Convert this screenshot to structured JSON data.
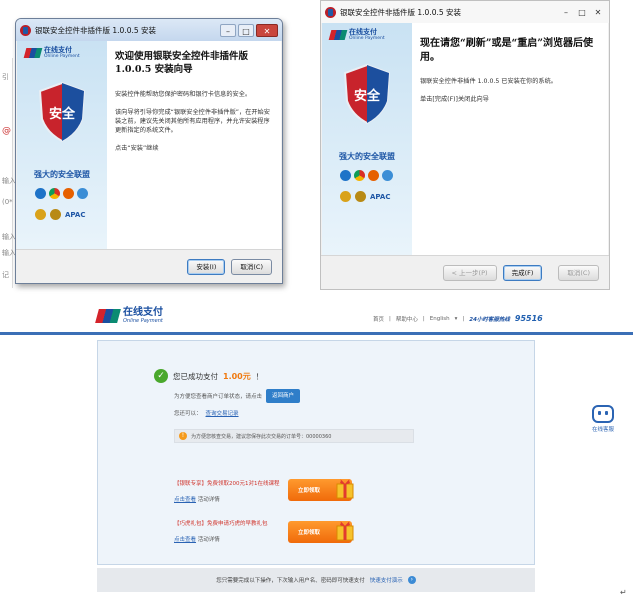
{
  "installer_welcome": {
    "title": "银联安全控件非插件版 1.0.0.5 安装",
    "heading": "欢迎使用银联安全控件非插件版 1.0.0.5 安装向导",
    "para1": "安装控件能帮助您保护密码和银行卡信息的安全。",
    "para2": "该向导将引导你完成“银联安全控件非插件版”，在开始安装之前，建议先关闭其他所有应用程序，并允许安装程序更新指定的系统文件。",
    "para3": "点击“安装”继续",
    "install_label": "安装(I)",
    "cancel_label": "取消(C)"
  },
  "installer_finish": {
    "title": "银联安全控件非插件版 1.0.0.5 安装",
    "heading": "现在请您“刷新”或是“重启”浏览器后使用。",
    "para1": "银联安全控件非插件 1.0.0.5 已安装在你的系统。",
    "para2": "单击[完成(F)]关闭此向导",
    "back_label": "< 上一步(P)",
    "finish_label": "完成(F)",
    "cancel_label": "取消(C)"
  },
  "sidebar": {
    "logo_text": "在线支付",
    "logo_sub": "Online Payment",
    "shield_text": "安全",
    "caption": "强大的安全联盟",
    "apac": "APAC"
  },
  "pay_header": {
    "logo_text": "在线支付",
    "logo_sub": "Online Payment",
    "nav_home": "首页",
    "nav_help": "帮助中心",
    "nav_lang": "English",
    "hotline_label": "24小时客服热线",
    "hotline_number": "95516"
  },
  "result": {
    "success_prefix": "您已成功支付",
    "amount": "1.00元",
    "success_suffix": "！",
    "view_status_text": "为方便您查看商户订单状态，请点击",
    "return_button": "返回商户",
    "also_can": "您还可以：",
    "query_link": "查询交易记录",
    "notice": "为方便您核查交易，建议您保存此次交易的订单号：00000360",
    "promo1_title": "【银联专享】免费领取200元1对1在线课程",
    "promo1_link": "点击查看",
    "promo1_detail": "活动详情",
    "promo1_button": "立即领取",
    "promo2_title": "【巧虎礼包】免费申请巧虎的早教礼包",
    "promo2_link": "点击查看",
    "promo2_detail": "活动详情",
    "promo2_button": "立即领取",
    "bottom_text": "您只需要完成以下操作，下次输入用户名、密码即可快速支付",
    "bottom_link": "快速支付演示"
  },
  "service": {
    "label": "在线客服"
  },
  "background_fragments": [
    "引",
    "输入",
    "(0*",
    "输入",
    "输入",
    "记"
  ],
  "colors": {
    "accent": "#1a4fa0",
    "orange": "#f07a10",
    "success": "#4aa82c"
  }
}
